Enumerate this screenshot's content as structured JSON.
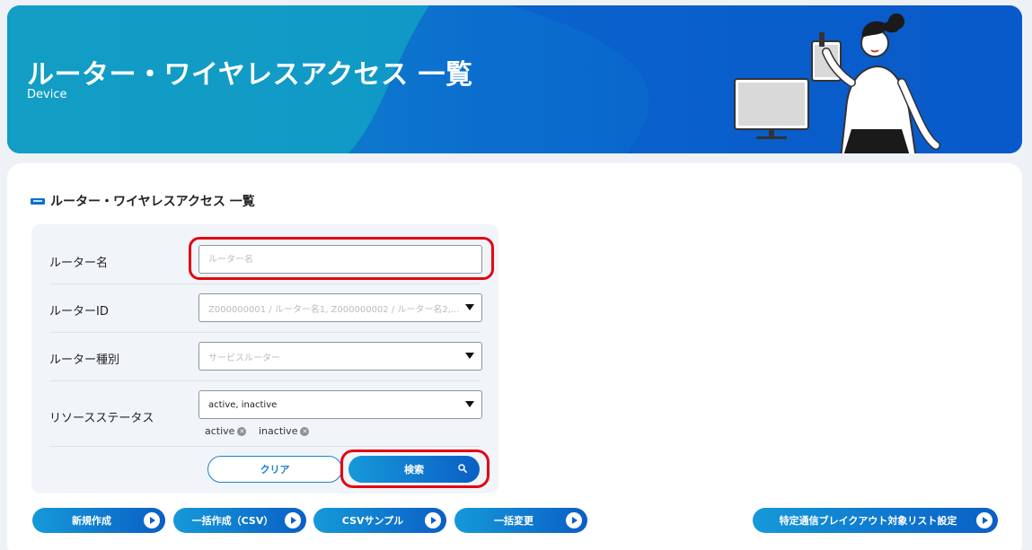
{
  "header": {
    "title": "ルーター・ワイヤレスアクセス 一覧",
    "subtitle": "Device"
  },
  "section": {
    "title": "ルーター・ワイヤレスアクセス 一覧"
  },
  "form": {
    "router_name": {
      "label": "ルーター名",
      "placeholder": "ルーター名",
      "value": ""
    },
    "router_id": {
      "label": "ルーターID",
      "placeholder": "Z000000001 / ルーター名1, Z000000002 / ルーター名2,..."
    },
    "router_type": {
      "label": "ルーター種別",
      "placeholder": "サービスルーター"
    },
    "resource_status": {
      "label": "リソースステータス",
      "value": "active, inactive",
      "chips": [
        "active",
        "inactive"
      ]
    },
    "clear_label": "クリア",
    "search_label": "検索"
  },
  "actions": {
    "new_label": "新規作成",
    "bulk_create_label": "一括作成（CSV）",
    "csv_sample_label": "CSVサンプル",
    "bulk_change_label": "一括変更",
    "breakout_label": "特定通信ブレイクアウト対象リスト設定"
  },
  "colors": {
    "accent": "#0a6fd0",
    "highlight": "#e30613"
  }
}
